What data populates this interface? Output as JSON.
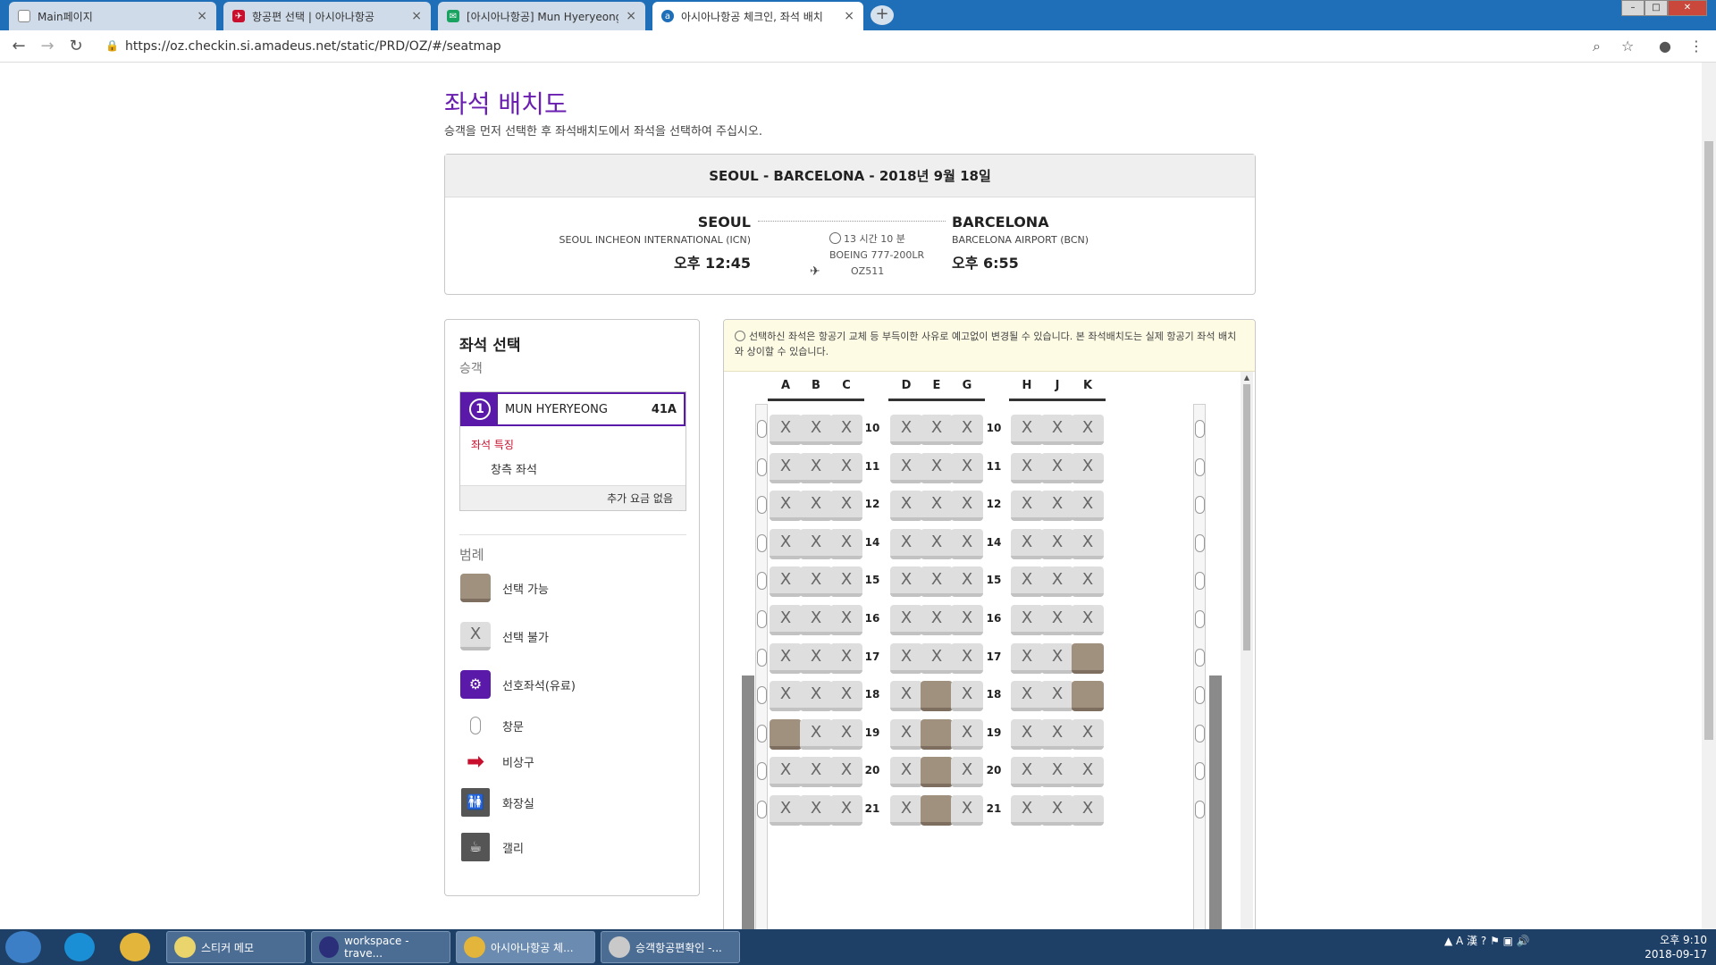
{
  "browser": {
    "tabs": [
      {
        "label": "Main페이지",
        "icon": "page-icon",
        "color": "#888888"
      },
      {
        "label": "항공편 선택 | 아시아나항공",
        "icon": "airline-logo-icon",
        "color": "#c8102e"
      },
      {
        "label": "[아시아나항공] Mun Hyeryeong",
        "icon": "mail-icon",
        "color": "#1aa260"
      },
      {
        "label": "아시아나항공 체크인, 좌석 배치",
        "icon": "amadeus-icon",
        "color": "#1f6fb8"
      }
    ],
    "url": "https://oz.checkin.si.amadeus.net/static/PRD/OZ/#/seatmap"
  },
  "page": {
    "title": "좌석 배치도",
    "subtitle": "승객을 먼저 선택한 후 좌석배치도에서 좌석을 선택하여 주십시오."
  },
  "flight": {
    "header": "SEOUL - BARCELONA - 2018년 9월 18일",
    "origin": {
      "city": "SEOUL",
      "airport": "SEOUL INCHEON INTERNATIONAL (ICN)",
      "time": "오후 12:45"
    },
    "destination": {
      "city": "BARCELONA",
      "airport": "BARCELONA AIRPORT (BCN)",
      "time": "오후 6:55"
    },
    "duration": "13 시간 10 분",
    "aircraft": "BOEING 777-200LR",
    "flight_no": "OZ511"
  },
  "seat_select": {
    "title": "좌석 선택",
    "passenger_label": "승객",
    "passenger": {
      "number": "1",
      "name": "MUN HYERYEONG",
      "seat": "41A"
    },
    "feature_label": "좌석 특징",
    "feature": "창측 좌석",
    "fee": "추가 요금 없음"
  },
  "legend": {
    "title": "범례",
    "items": [
      {
        "label": "선택 가능",
        "icon": "available-seat-icon"
      },
      {
        "label": "선택 불가",
        "icon": "unavailable-seat-icon",
        "mark": "X"
      },
      {
        "label": "선호좌석(유료)",
        "icon": "preferred-seat-icon"
      },
      {
        "label": "창문",
        "icon": "window-icon"
      },
      {
        "label": "비상구",
        "icon": "exit-arrow-icon"
      },
      {
        "label": "화장실",
        "icon": "restroom-icon"
      },
      {
        "label": "갤리",
        "icon": "galley-icon"
      }
    ]
  },
  "seatmap": {
    "notice": "선택하신 좌석은 항공기 교체 등 부득이한 사유로 예고없이 변경될 수 있습니다. 본 좌석배치도는 실제 항공기 좌석 배치와 상이할 수 있습니다.",
    "columns": [
      "A",
      "B",
      "C",
      "D",
      "E",
      "G",
      "H",
      "J",
      "K"
    ],
    "unavailable_mark": "X",
    "rows": [
      {
        "row": "10",
        "seats": [
          "X",
          "X",
          "X",
          "X",
          "X",
          "X",
          "X",
          "X",
          "X"
        ]
      },
      {
        "row": "11",
        "seats": [
          "X",
          "X",
          "X",
          "X",
          "X",
          "X",
          "X",
          "X",
          "X"
        ]
      },
      {
        "row": "12",
        "seats": [
          "X",
          "X",
          "X",
          "X",
          "X",
          "X",
          "X",
          "X",
          "X"
        ]
      },
      {
        "row": "14",
        "seats": [
          "X",
          "X",
          "X",
          "X",
          "X",
          "X",
          "X",
          "X",
          "X"
        ]
      },
      {
        "row": "15",
        "seats": [
          "X",
          "X",
          "X",
          "X",
          "X",
          "X",
          "X",
          "X",
          "X"
        ]
      },
      {
        "row": "16",
        "seats": [
          "X",
          "X",
          "X",
          "X",
          "X",
          "X",
          "X",
          "X",
          "X"
        ]
      },
      {
        "row": "17",
        "seats": [
          "X",
          "X",
          "X",
          "X",
          "X",
          "X",
          "X",
          "X",
          "O"
        ]
      },
      {
        "row": "18",
        "seats": [
          "X",
          "X",
          "X",
          "X",
          "O",
          "X",
          "X",
          "X",
          "O"
        ]
      },
      {
        "row": "19",
        "seats": [
          "O",
          "X",
          "X",
          "X",
          "O",
          "X",
          "X",
          "X",
          "X"
        ]
      },
      {
        "row": "20",
        "seats": [
          "X",
          "X",
          "X",
          "X",
          "O",
          "X",
          "X",
          "X",
          "X"
        ]
      },
      {
        "row": "21",
        "seats": [
          "X",
          "X",
          "X",
          "X",
          "O",
          "X",
          "X",
          "X",
          "X"
        ]
      }
    ],
    "colors": {
      "available": "#a0907e",
      "unavailable": "#dedede",
      "accent": "#5a19a8"
    }
  },
  "taskbar": {
    "items": [
      {
        "label": "스티커 메모"
      },
      {
        "label": "workspace - trave..."
      },
      {
        "label": "아시아나항공 체..."
      },
      {
        "label": "승객항공편확인 -..."
      }
    ],
    "clock_time": "오후 9:10",
    "clock_date": "2018-09-17"
  }
}
